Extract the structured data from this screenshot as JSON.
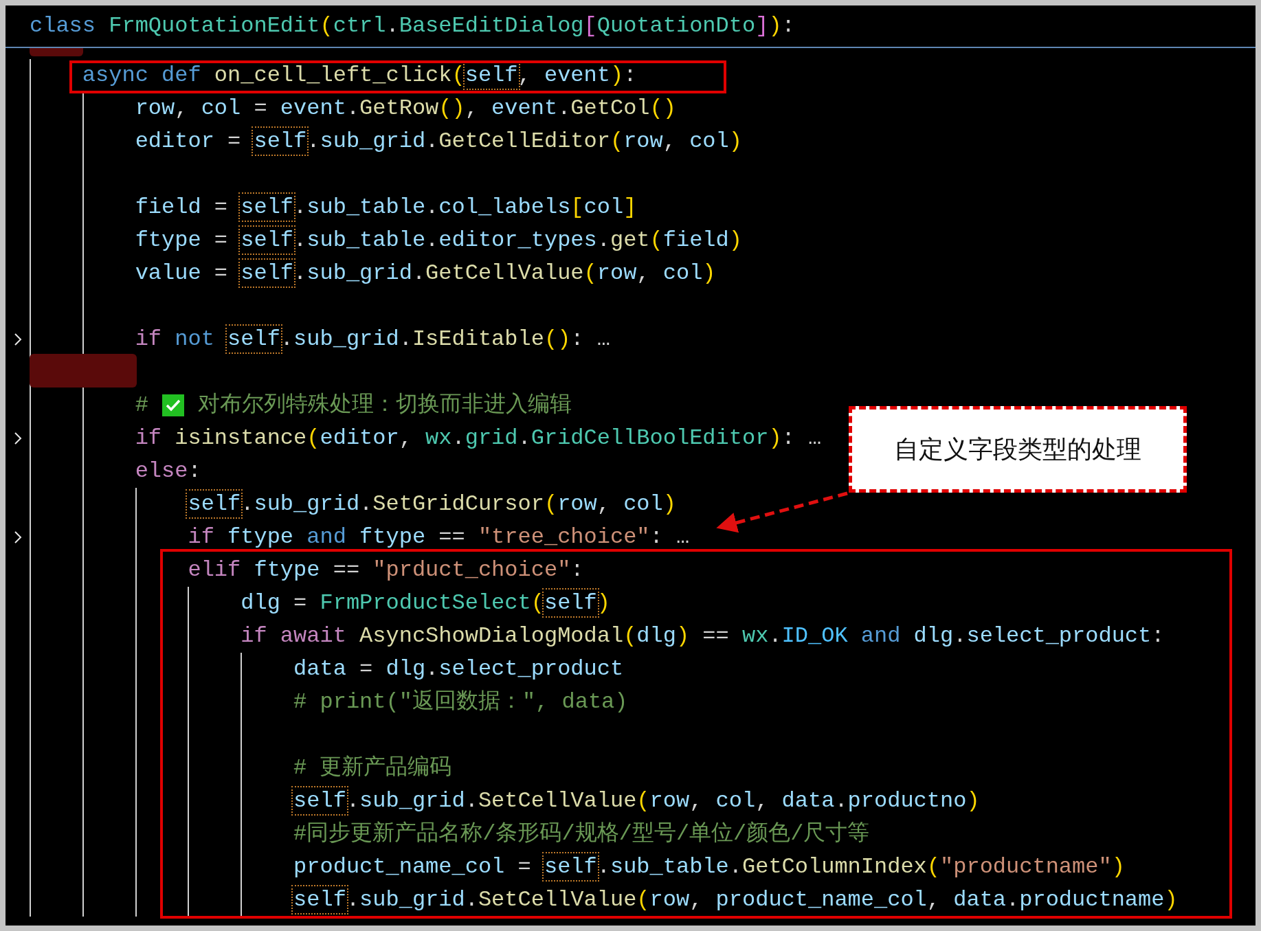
{
  "header": {
    "tokens": [
      {
        "text": "class ",
        "kind": "kw"
      },
      {
        "text": "FrmQuotationEdit",
        "kind": "type"
      },
      {
        "text": "(",
        "kind": "br1"
      },
      {
        "text": "ctrl",
        "kind": "type"
      },
      {
        "text": ".",
        "kind": "op"
      },
      {
        "text": "BaseEditDialog",
        "kind": "type"
      },
      {
        "text": "[",
        "kind": "br2"
      },
      {
        "text": "QuotationDto",
        "kind": "type"
      },
      {
        "text": "]",
        "kind": "br2"
      },
      {
        "text": ")",
        "kind": "br1"
      },
      {
        "text": ":",
        "kind": "op"
      }
    ],
    "children": [
      {
        "kind": "code",
        "folded": false,
        "tokens": [
          {
            "text": "async def ",
            "kind": "kw"
          },
          {
            "text": "on_cell_left_click",
            "kind": "fn"
          },
          {
            "text": "(",
            "kind": "br1"
          },
          {
            "text": "self",
            "kind": "self"
          },
          {
            "text": ", ",
            "kind": "op"
          },
          {
            "text": "event",
            "kind": "var"
          },
          {
            "text": ")",
            "kind": "br1"
          },
          {
            "text": ":",
            "kind": "op"
          }
        ],
        "children": [
          {
            "kind": "code",
            "folded": false,
            "tokens": [
              {
                "text": "row",
                "kind": "var"
              },
              {
                "text": ", ",
                "kind": "op"
              },
              {
                "text": "col",
                "kind": "var"
              },
              {
                "text": " = ",
                "kind": "op"
              },
              {
                "text": "event",
                "kind": "var"
              },
              {
                "text": ".",
                "kind": "op"
              },
              {
                "text": "GetRow",
                "kind": "fn"
              },
              {
                "text": "()",
                "kind": "br1"
              },
              {
                "text": ", ",
                "kind": "op"
              },
              {
                "text": "event",
                "kind": "var"
              },
              {
                "text": ".",
                "kind": "op"
              },
              {
                "text": "GetCol",
                "kind": "fn"
              },
              {
                "text": "()",
                "kind": "br1"
              }
            ]
          },
          {
            "kind": "code",
            "folded": false,
            "tokens": [
              {
                "text": "editor",
                "kind": "var"
              },
              {
                "text": " = ",
                "kind": "op"
              },
              {
                "text": "self",
                "kind": "self"
              },
              {
                "text": ".",
                "kind": "op"
              },
              {
                "text": "sub_grid",
                "kind": "var"
              },
              {
                "text": ".",
                "kind": "op"
              },
              {
                "text": "GetCellEditor",
                "kind": "fn"
              },
              {
                "text": "(",
                "kind": "br1"
              },
              {
                "text": "row",
                "kind": "var"
              },
              {
                "text": ", ",
                "kind": "op"
              },
              {
                "text": "col",
                "kind": "var"
              },
              {
                "text": ")",
                "kind": "br1"
              }
            ]
          },
          {
            "kind": "blank"
          },
          {
            "kind": "code",
            "folded": false,
            "tokens": [
              {
                "text": "field",
                "kind": "var"
              },
              {
                "text": " = ",
                "kind": "op"
              },
              {
                "text": "self",
                "kind": "self"
              },
              {
                "text": ".",
                "kind": "op"
              },
              {
                "text": "sub_table",
                "kind": "var"
              },
              {
                "text": ".",
                "kind": "op"
              },
              {
                "text": "col_labels",
                "kind": "var"
              },
              {
                "text": "[",
                "kind": "br1"
              },
              {
                "text": "col",
                "kind": "var"
              },
              {
                "text": "]",
                "kind": "br1"
              }
            ]
          },
          {
            "kind": "code",
            "folded": false,
            "tokens": [
              {
                "text": "ftype",
                "kind": "var"
              },
              {
                "text": " = ",
                "kind": "op"
              },
              {
                "text": "self",
                "kind": "self"
              },
              {
                "text": ".",
                "kind": "op"
              },
              {
                "text": "sub_table",
                "kind": "var"
              },
              {
                "text": ".",
                "kind": "op"
              },
              {
                "text": "editor_types",
                "kind": "var"
              },
              {
                "text": ".",
                "kind": "op"
              },
              {
                "text": "get",
                "kind": "fn"
              },
              {
                "text": "(",
                "kind": "br1"
              },
              {
                "text": "field",
                "kind": "var"
              },
              {
                "text": ")",
                "kind": "br1"
              }
            ]
          },
          {
            "kind": "code",
            "folded": false,
            "tokens": [
              {
                "text": "value",
                "kind": "var"
              },
              {
                "text": " = ",
                "kind": "op"
              },
              {
                "text": "self",
                "kind": "self"
              },
              {
                "text": ".",
                "kind": "op"
              },
              {
                "text": "sub_grid",
                "kind": "var"
              },
              {
                "text": ".",
                "kind": "op"
              },
              {
                "text": "GetCellValue",
                "kind": "fn"
              },
              {
                "text": "(",
                "kind": "br1"
              },
              {
                "text": "row",
                "kind": "var"
              },
              {
                "text": ", ",
                "kind": "op"
              },
              {
                "text": "col",
                "kind": "var"
              },
              {
                "text": ")",
                "kind": "br1"
              }
            ]
          },
          {
            "kind": "blank"
          },
          {
            "kind": "code",
            "folded": true,
            "tokens": [
              {
                "text": "if ",
                "kind": "ctl"
              },
              {
                "text": "not ",
                "kind": "kw"
              },
              {
                "text": "self",
                "kind": "self"
              },
              {
                "text": ".",
                "kind": "op"
              },
              {
                "text": "sub_grid",
                "kind": "var"
              },
              {
                "text": ".",
                "kind": "op"
              },
              {
                "text": "IsEditable",
                "kind": "fn"
              },
              {
                "text": "()",
                "kind": "br1"
              },
              {
                "text": ": …",
                "kind": "op"
              }
            ]
          },
          {
            "kind": "blank"
          },
          {
            "kind": "code",
            "folded": false,
            "tokens": [
              {
                "text": "#",
                "kind": "cmt"
              },
              {
                "kind": "check"
              },
              {
                "text": "对布尔列特殊处理：切换而非进入编辑",
                "kind": "cmt"
              }
            ]
          },
          {
            "kind": "code",
            "folded": true,
            "tokens": [
              {
                "text": "if ",
                "kind": "ctl"
              },
              {
                "text": "isinstance",
                "kind": "fn"
              },
              {
                "text": "(",
                "kind": "br1"
              },
              {
                "text": "editor",
                "kind": "var"
              },
              {
                "text": ", ",
                "kind": "op"
              },
              {
                "text": "wx",
                "kind": "type"
              },
              {
                "text": ".",
                "kind": "op"
              },
              {
                "text": "grid",
                "kind": "type"
              },
              {
                "text": ".",
                "kind": "op"
              },
              {
                "text": "GridCellBoolEditor",
                "kind": "type"
              },
              {
                "text": ")",
                "kind": "br1"
              },
              {
                "text": ": …",
                "kind": "op"
              }
            ]
          },
          {
            "kind": "code",
            "folded": false,
            "tokens": [
              {
                "text": "else",
                "kind": "ctl"
              },
              {
                "text": ":",
                "kind": "op"
              }
            ],
            "children": [
              {
                "kind": "code",
                "folded": false,
                "tokens": [
                  {
                    "text": "self",
                    "kind": "self"
                  },
                  {
                    "text": ".",
                    "kind": "op"
                  },
                  {
                    "text": "sub_grid",
                    "kind": "var"
                  },
                  {
                    "text": ".",
                    "kind": "op"
                  },
                  {
                    "text": "SetGridCursor",
                    "kind": "fn"
                  },
                  {
                    "text": "(",
                    "kind": "br1"
                  },
                  {
                    "text": "row",
                    "kind": "var"
                  },
                  {
                    "text": ", ",
                    "kind": "op"
                  },
                  {
                    "text": "col",
                    "kind": "var"
                  },
                  {
                    "text": ")",
                    "kind": "br1"
                  }
                ]
              },
              {
                "kind": "code",
                "folded": true,
                "tokens": [
                  {
                    "text": "if ",
                    "kind": "ctl"
                  },
                  {
                    "text": "ftype ",
                    "kind": "var"
                  },
                  {
                    "text": "and ",
                    "kind": "kw"
                  },
                  {
                    "text": "ftype",
                    "kind": "var"
                  },
                  {
                    "text": " == ",
                    "kind": "op"
                  },
                  {
                    "text": "\"tree_choice\"",
                    "kind": "str"
                  },
                  {
                    "text": ": …",
                    "kind": "op"
                  }
                ]
              },
              {
                "kind": "code",
                "folded": false,
                "tokens": [
                  {
                    "text": "elif ",
                    "kind": "ctl"
                  },
                  {
                    "text": "ftype",
                    "kind": "var"
                  },
                  {
                    "text": " == ",
                    "kind": "op"
                  },
                  {
                    "text": "\"prduct_choice\"",
                    "kind": "str"
                  },
                  {
                    "text": ":",
                    "kind": "op"
                  }
                ],
                "children": [
                  {
                    "kind": "code",
                    "folded": false,
                    "tokens": [
                      {
                        "text": "dlg",
                        "kind": "var"
                      },
                      {
                        "text": " = ",
                        "kind": "op"
                      },
                      {
                        "text": "FrmProductSelect",
                        "kind": "type"
                      },
                      {
                        "text": "(",
                        "kind": "br1"
                      },
                      {
                        "text": "self",
                        "kind": "self"
                      },
                      {
                        "text": ")",
                        "kind": "br1"
                      }
                    ]
                  },
                  {
                    "kind": "code",
                    "folded": false,
                    "tokens": [
                      {
                        "text": "if await ",
                        "kind": "ctl"
                      },
                      {
                        "text": "AsyncShowDialogModal",
                        "kind": "fn"
                      },
                      {
                        "text": "(",
                        "kind": "br1"
                      },
                      {
                        "text": "dlg",
                        "kind": "var"
                      },
                      {
                        "text": ")",
                        "kind": "br1"
                      },
                      {
                        "text": " == ",
                        "kind": "op"
                      },
                      {
                        "text": "wx",
                        "kind": "type"
                      },
                      {
                        "text": ".",
                        "kind": "op"
                      },
                      {
                        "text": "ID_OK",
                        "kind": "const"
                      },
                      {
                        "text": " and ",
                        "kind": "kw"
                      },
                      {
                        "text": "dlg",
                        "kind": "var"
                      },
                      {
                        "text": ".",
                        "kind": "op"
                      },
                      {
                        "text": "select_product",
                        "kind": "var"
                      },
                      {
                        "text": ":",
                        "kind": "op"
                      }
                    ],
                    "children": [
                      {
                        "kind": "code",
                        "folded": false,
                        "tokens": [
                          {
                            "text": "data",
                            "kind": "var"
                          },
                          {
                            "text": " = ",
                            "kind": "op"
                          },
                          {
                            "text": "dlg",
                            "kind": "var"
                          },
                          {
                            "text": ".",
                            "kind": "op"
                          },
                          {
                            "text": "select_product",
                            "kind": "var"
                          }
                        ]
                      },
                      {
                        "kind": "code",
                        "folded": false,
                        "tokens": [
                          {
                            "text": "# print(\"返回数据：\", data)",
                            "kind": "cmt"
                          }
                        ]
                      },
                      {
                        "kind": "blank"
                      },
                      {
                        "kind": "code",
                        "folded": false,
                        "tokens": [
                          {
                            "text": "# 更新产品编码",
                            "kind": "cmt"
                          }
                        ]
                      },
                      {
                        "kind": "code",
                        "folded": false,
                        "tokens": [
                          {
                            "text": "self",
                            "kind": "self"
                          },
                          {
                            "text": ".",
                            "kind": "op"
                          },
                          {
                            "text": "sub_grid",
                            "kind": "var"
                          },
                          {
                            "text": ".",
                            "kind": "op"
                          },
                          {
                            "text": "SetCellValue",
                            "kind": "fn"
                          },
                          {
                            "text": "(",
                            "kind": "br1"
                          },
                          {
                            "text": "row",
                            "kind": "var"
                          },
                          {
                            "text": ", ",
                            "kind": "op"
                          },
                          {
                            "text": "col",
                            "kind": "var"
                          },
                          {
                            "text": ", ",
                            "kind": "op"
                          },
                          {
                            "text": "data",
                            "kind": "var"
                          },
                          {
                            "text": ".",
                            "kind": "op"
                          },
                          {
                            "text": "productno",
                            "kind": "var"
                          },
                          {
                            "text": ")",
                            "kind": "br1"
                          }
                        ]
                      },
                      {
                        "kind": "code",
                        "folded": false,
                        "tokens": [
                          {
                            "text": "#同步更新产品名称/条形码/规格/型号/单位/颜色/尺寸等",
                            "kind": "cmt"
                          }
                        ]
                      },
                      {
                        "kind": "code",
                        "folded": false,
                        "tokens": [
                          {
                            "text": "product_name_col",
                            "kind": "var"
                          },
                          {
                            "text": " = ",
                            "kind": "op"
                          },
                          {
                            "text": "self",
                            "kind": "self"
                          },
                          {
                            "text": ".",
                            "kind": "op"
                          },
                          {
                            "text": "sub_table",
                            "kind": "var"
                          },
                          {
                            "text": ".",
                            "kind": "op"
                          },
                          {
                            "text": "GetColumnIndex",
                            "kind": "fn"
                          },
                          {
                            "text": "(",
                            "kind": "br1"
                          },
                          {
                            "text": "\"productname\"",
                            "kind": "str"
                          },
                          {
                            "text": ")",
                            "kind": "br1"
                          }
                        ]
                      },
                      {
                        "kind": "code",
                        "folded": false,
                        "tokens": [
                          {
                            "text": "self",
                            "kind": "self"
                          },
                          {
                            "text": ".",
                            "kind": "op"
                          },
                          {
                            "text": "sub_grid",
                            "kind": "var"
                          },
                          {
                            "text": ".",
                            "kind": "op"
                          },
                          {
                            "text": "SetCellValue",
                            "kind": "fn"
                          },
                          {
                            "text": "(",
                            "kind": "br1"
                          },
                          {
                            "text": "row",
                            "kind": "var"
                          },
                          {
                            "text": ", ",
                            "kind": "op"
                          },
                          {
                            "text": "product_name_col",
                            "kind": "var"
                          },
                          {
                            "text": ", ",
                            "kind": "op"
                          },
                          {
                            "text": "data",
                            "kind": "var"
                          },
                          {
                            "text": ".",
                            "kind": "op"
                          },
                          {
                            "text": "productname",
                            "kind": "var"
                          },
                          {
                            "text": ")",
                            "kind": "br1"
                          }
                        ]
                      }
                    ]
                  }
                ]
              }
            ]
          }
        ]
      }
    ]
  },
  "callout": {
    "text": "自定义字段类型的处理"
  }
}
